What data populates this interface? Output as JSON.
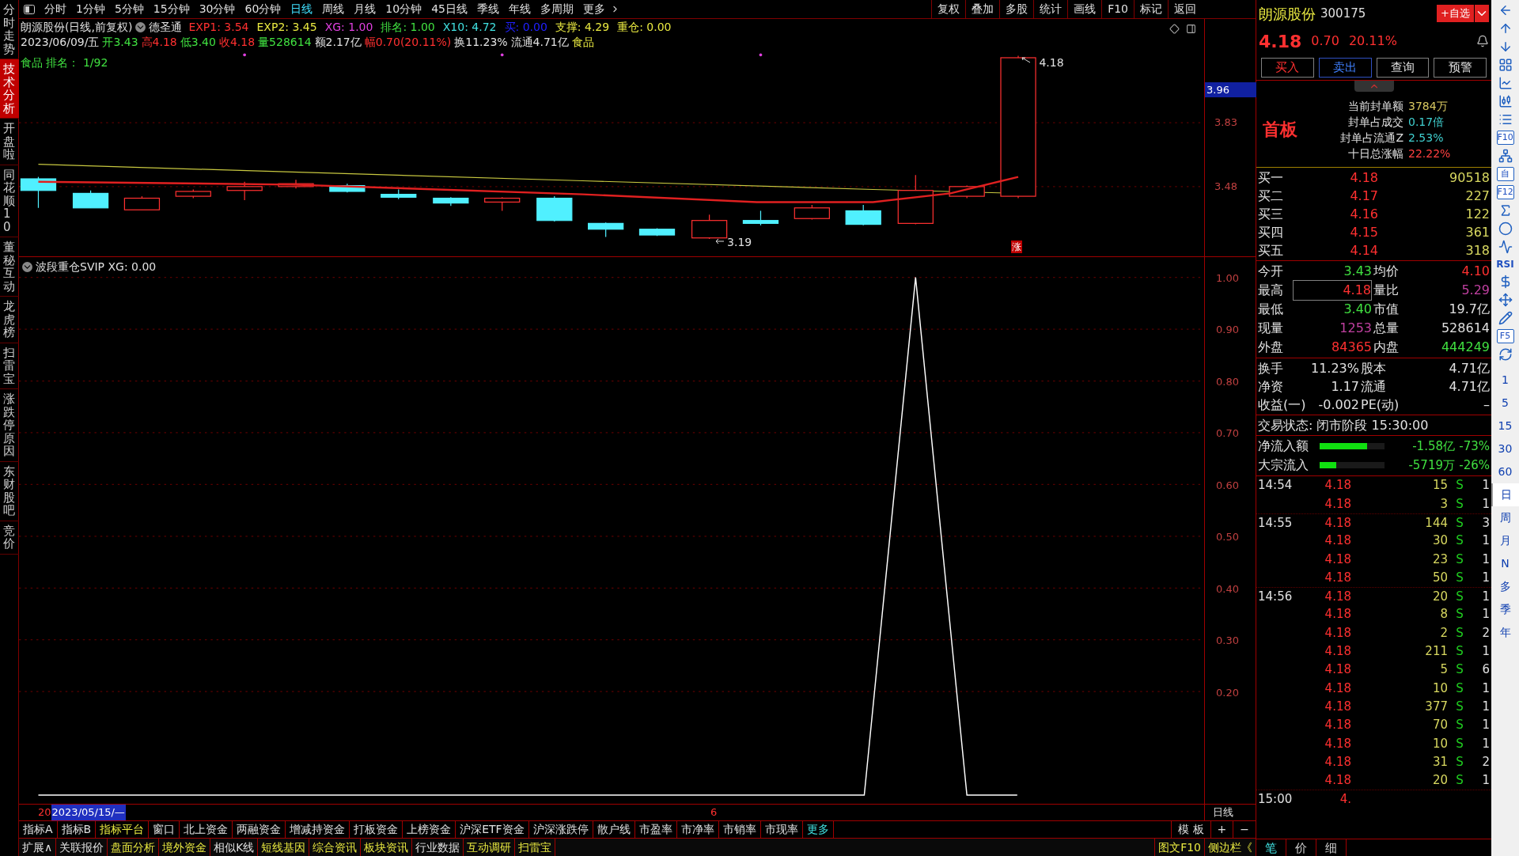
{
  "left_tabs": [
    {
      "label": "分时走势",
      "selected": false
    },
    {
      "label": "技术分析",
      "selected": true
    },
    {
      "label": "开盘啦",
      "selected": false
    },
    {
      "label": "同花顺10",
      "selected": false
    },
    {
      "label": "董秘互动",
      "selected": false
    },
    {
      "label": "龙虎榜",
      "selected": false
    },
    {
      "label": "扫雷宝",
      "selected": false
    },
    {
      "label": "涨跌停原因",
      "selected": false
    },
    {
      "label": "东财股吧",
      "selected": false
    },
    {
      "label": "竞价",
      "selected": false
    }
  ],
  "period_tabs": [
    {
      "label": "分时",
      "selected": false
    },
    {
      "label": "1分钟",
      "selected": false
    },
    {
      "label": "5分钟",
      "selected": false
    },
    {
      "label": "15分钟",
      "selected": false
    },
    {
      "label": "30分钟",
      "selected": false
    },
    {
      "label": "60分钟",
      "selected": false
    },
    {
      "label": "日线",
      "selected": true
    },
    {
      "label": "周线",
      "selected": false
    },
    {
      "label": "月线",
      "selected": false
    },
    {
      "label": "10分钟",
      "selected": false
    },
    {
      "label": "45日线",
      "selected": false
    },
    {
      "label": "季线",
      "selected": false
    },
    {
      "label": "年线",
      "selected": false
    },
    {
      "label": "多周期",
      "selected": false
    },
    {
      "label": "更多",
      "selected": false
    }
  ],
  "toolbar_buttons": [
    "复权",
    "叠加",
    "多股",
    "统计",
    "画线",
    "F10",
    "标记",
    "返回"
  ],
  "chart_header": {
    "title": "朗源股份(日线,前复权)",
    "formula": "德圣通",
    "indicators": [
      {
        "text": "EXP1: 3.54",
        "color": "#ff3030"
      },
      {
        "text": "EXP2: 3.45",
        "color": "#e8e840"
      },
      {
        "text": "XG: 1.00",
        "color": "#e040e0"
      },
      {
        "text": "排名: 1.00",
        "color": "#40e040"
      },
      {
        "text": "X10: 4.72",
        "color": "#40e0e0"
      },
      {
        "text": "买: 0.00",
        "color": "#2020ff"
      },
      {
        "text": "支撑: 4.29",
        "color": "#e8e840"
      },
      {
        "text": "重仓: 0.00",
        "color": "#e8e840"
      }
    ],
    "quote": [
      {
        "text": "2023/06/09/五",
        "color": "#e0e0e0"
      },
      {
        "text": "开3.43",
        "color": "#40e040"
      },
      {
        "text": "高4.18",
        "color": "#ff3030"
      },
      {
        "text": "低3.40",
        "color": "#40e040"
      },
      {
        "text": "收4.18",
        "color": "#ff3030"
      },
      {
        "text": "量528614",
        "color": "#40e040"
      },
      {
        "text": "额2.17亿",
        "color": "#e0e0e0"
      },
      {
        "text": "幅0.70(20.11%)",
        "color": "#ff3030"
      },
      {
        "text": "换11.23%",
        "color": "#e0e0e0"
      },
      {
        "text": "流通4.71亿",
        "color": "#e0e0e0"
      },
      {
        "text": "食品",
        "color": "#e8e840"
      }
    ],
    "rank": "食品 排名： 1/92"
  },
  "price_chart": {
    "high_label": "4.18",
    "low_label": "3.19",
    "limit_badge": "涨",
    "axis": {
      "current": "3.96",
      "ticks": [
        "3.83",
        "3.48"
      ]
    }
  },
  "indicator_pane": {
    "title": "波段重仓SVIP XG: 0.00",
    "axis_labels": [
      "1.00",
      "0.90",
      "0.80",
      "0.70",
      "0.60",
      "0.50",
      "0.40",
      "0.30",
      "0.20"
    ]
  },
  "date_bar": {
    "year_mark": "20",
    "date": "2023/05/15/—",
    "month_mark": "6",
    "period": "日线"
  },
  "indicator_tabs": [
    {
      "label": "指标A",
      "color": "#e0e0e0"
    },
    {
      "label": "指标B",
      "color": "#e0e0e0"
    },
    {
      "label": "指标平台",
      "color": "#e8e840"
    },
    {
      "label": "窗口",
      "color": "#e0e0e0"
    },
    {
      "label": "北上资金",
      "color": "#e0e0e0"
    },
    {
      "label": "两融资金",
      "color": "#e0e0e0"
    },
    {
      "label": "增减持资金",
      "color": "#e0e0e0"
    },
    {
      "label": "打板资金",
      "color": "#e0e0e0"
    },
    {
      "label": "上榜资金",
      "color": "#e0e0e0"
    },
    {
      "label": "沪深ETF资金",
      "color": "#e0e0e0"
    },
    {
      "label": "沪深涨跌停",
      "color": "#e0e0e0"
    },
    {
      "label": "散户线",
      "color": "#e0e0e0"
    },
    {
      "label": "市盈率",
      "color": "#e0e0e0"
    },
    {
      "label": "市净率",
      "color": "#e0e0e0"
    },
    {
      "label": "市销率",
      "color": "#e0e0e0"
    },
    {
      "label": "市现率",
      "color": "#e0e0e0"
    },
    {
      "label": "更多",
      "color": "#40e0e0"
    }
  ],
  "indicator_tools": [
    "模 板",
    "+",
    "−"
  ],
  "status_bar": {
    "items": [
      {
        "label": "扩展∧",
        "color": "#e0e0e0"
      },
      {
        "label": "关联报价",
        "color": "#e0e0e0"
      },
      {
        "label": "盘面分析",
        "color": "#e8e840"
      },
      {
        "label": "境外资金",
        "color": "#e8e840"
      },
      {
        "label": "相似K线",
        "color": "#e0e0e0"
      },
      {
        "label": "短线基因",
        "color": "#e8e840"
      },
      {
        "label": "综合资讯",
        "color": "#e8e840"
      },
      {
        "label": "板块资讯",
        "color": "#e8e840"
      },
      {
        "label": "行业数据",
        "color": "#e0e0e0"
      },
      {
        "label": "互动调研",
        "color": "#e8e840"
      },
      {
        "label": "扫雷宝",
        "color": "#e8e840"
      }
    ],
    "right": [
      "图文F10",
      "侧边栏《"
    ]
  },
  "quote_panel": {
    "name": "朗源股份",
    "code": "300175",
    "watch_button": "+自选",
    "price": "4.18",
    "change": "0.70",
    "change_pct": "20.11%",
    "actions": [
      {
        "label": "买入",
        "color": "#ff3030"
      },
      {
        "label": "卖出",
        "color": "#4080ff"
      },
      {
        "label": "查询",
        "color": "#e0e0e0"
      },
      {
        "label": "预警",
        "color": "#e0e0e0"
      }
    ],
    "board_tag": "首板",
    "seal_info": [
      {
        "label": "当前封单额",
        "value": "3784万",
        "color": "#d8c860"
      },
      {
        "label": "封单占成交",
        "value": "0.17倍",
        "color": "#40d0d0"
      },
      {
        "label": "封单占流通Z",
        "value": "2.53%",
        "color": "#40d0d0"
      },
      {
        "label": "十日总涨幅",
        "value": "22.22%",
        "color": "#ff4040"
      }
    ],
    "bids": [
      {
        "label": "买一",
        "price": "4.18",
        "volume": "90518"
      },
      {
        "label": "买二",
        "price": "4.17",
        "volume": "227"
      },
      {
        "label": "买三",
        "price": "4.16",
        "volume": "122"
      },
      {
        "label": "买四",
        "price": "4.15",
        "volume": "361"
      },
      {
        "label": "买五",
        "price": "4.14",
        "volume": "318"
      }
    ],
    "stats": [
      [
        {
          "label": "今开",
          "value": "3.43",
          "color": "#40e040",
          "highlighted": false
        },
        {
          "label": "均价",
          "value": "4.10",
          "color": "#ff3030",
          "highlighted": false
        }
      ],
      [
        {
          "label": "最高",
          "value": "4.18",
          "color": "#ff3030",
          "highlighted": true
        },
        {
          "label": "量比",
          "value": "5.29",
          "color": "#c040a0",
          "highlighted": false
        }
      ],
      [
        {
          "label": "最低",
          "value": "3.40",
          "color": "#40e040",
          "highlighted": false
        },
        {
          "label": "市值",
          "value": "19.7亿",
          "color": "#e0e0e0",
          "highlighted": false
        }
      ],
      [
        {
          "label": "现量",
          "value": "1253",
          "color": "#c040a0",
          "highlighted": false
        },
        {
          "label": "总量",
          "value": "528614",
          "color": "#e0e0e0",
          "highlighted": false
        }
      ],
      [
        {
          "label": "外盘",
          "value": "84365",
          "color": "#ff3030",
          "highlighted": false
        },
        {
          "label": "内盘",
          "value": "444249",
          "color": "#40e040",
          "highlighted": false
        }
      ]
    ],
    "fundamentals": [
      [
        {
          "label": "换手",
          "value": "11.23%"
        },
        {
          "label": "股本",
          "value": "4.71亿"
        }
      ],
      [
        {
          "label": "净资",
          "value": "1.17"
        },
        {
          "label": "流通",
          "value": "4.71亿"
        }
      ],
      [
        {
          "label": "收益(一)",
          "value": "-0.002"
        },
        {
          "label": "PE(动)",
          "value": "–"
        }
      ]
    ],
    "trade_status": "交易状态: 闭市阶段 15:30:00",
    "flows": [
      {
        "label": "净流入额",
        "level": 0.73,
        "amount": "-1.58亿",
        "pct": "-73%"
      },
      {
        "label": "大宗流入",
        "level": 0.26,
        "amount": "-5719万",
        "pct": "-26%"
      }
    ],
    "ticks": [
      {
        "time": "14:54",
        "price": "4.18",
        "volume": "15",
        "side": "S",
        "count": "1"
      },
      {
        "price": "4.18",
        "volume": "3",
        "side": "S",
        "count": "1"
      },
      {
        "time": "14:55",
        "price": "4.18",
        "volume": "144",
        "side": "S",
        "count": "3"
      },
      {
        "price": "4.18",
        "volume": "30",
        "side": "S",
        "count": "1"
      },
      {
        "price": "4.18",
        "volume": "23",
        "side": "S",
        "count": "1"
      },
      {
        "price": "4.18",
        "volume": "50",
        "side": "S",
        "count": "1"
      },
      {
        "time": "14:56",
        "price": "4.18",
        "volume": "20",
        "side": "S",
        "count": "1"
      },
      {
        "price": "4.18",
        "volume": "8",
        "side": "S",
        "count": "1"
      },
      {
        "price": "4.18",
        "volume": "2",
        "side": "S",
        "count": "2"
      },
      {
        "price": "4.18",
        "volume": "211",
        "side": "S",
        "count": "1"
      },
      {
        "price": "4.18",
        "volume": "5",
        "side": "S",
        "count": "6"
      },
      {
        "price": "4.18",
        "volume": "10",
        "side": "S",
        "count": "1"
      },
      {
        "price": "4.18",
        "volume": "377",
        "side": "S",
        "count": "1"
      },
      {
        "price": "4.18",
        "volume": "70",
        "side": "S",
        "count": "1"
      },
      {
        "price": "4.18",
        "volume": "10",
        "side": "S",
        "count": "1"
      },
      {
        "price": "4.18",
        "volume": "31",
        "side": "S",
        "count": "2"
      },
      {
        "price": "4.18",
        "volume": "20",
        "side": "S",
        "count": "1"
      },
      {
        "time": "15:00",
        "price": "4."
      }
    ],
    "bottom_tabs": [
      {
        "label": "笔",
        "selected": true
      },
      {
        "label": "价",
        "selected": false
      },
      {
        "label": "细",
        "selected": false
      }
    ]
  },
  "sidebar": {
    "items": [
      {
        "kind": "icon"
      },
      {
        "kind": "icon"
      },
      {
        "kind": "icon"
      },
      {
        "kind": "icon"
      },
      {
        "kind": "icon"
      },
      {
        "kind": "icon"
      },
      {
        "kind": "icon"
      },
      {
        "kind": "boxed",
        "label": "F10"
      },
      {
        "kind": "icon"
      },
      {
        "kind": "boxed",
        "label": "自"
      },
      {
        "kind": "boxed",
        "label": "F12"
      },
      {
        "kind": "icon"
      },
      {
        "kind": "icon"
      },
      {
        "kind": "icon"
      },
      {
        "kind": "text",
        "label": "RSI"
      },
      {
        "kind": "icon"
      },
      {
        "kind": "icon"
      },
      {
        "kind": "icon"
      },
      {
        "kind": "boxed",
        "label": "F5"
      },
      {
        "kind": "icon"
      }
    ],
    "periods": [
      {
        "label": "1",
        "selected": false
      },
      {
        "label": "5",
        "selected": false
      },
      {
        "label": "15",
        "selected": false
      },
      {
        "label": "30",
        "selected": false
      },
      {
        "label": "60",
        "selected": false
      },
      {
        "label": "日",
        "selected": true
      },
      {
        "label": "周",
        "selected": false
      },
      {
        "label": "月",
        "selected": false
      },
      {
        "label": "N",
        "selected": false
      },
      {
        "label": "多",
        "selected": false
      },
      {
        "label": "季",
        "selected": false
      },
      {
        "label": "年",
        "selected": false
      }
    ]
  }
}
